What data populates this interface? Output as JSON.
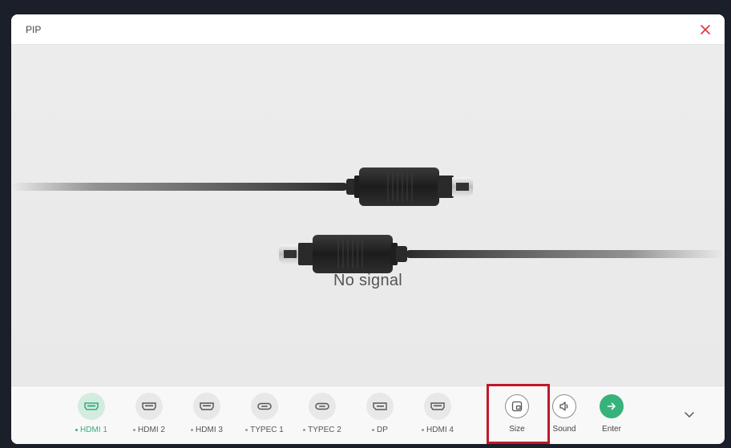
{
  "window": {
    "title": "PIP"
  },
  "content": {
    "message": "No signal"
  },
  "sources": [
    {
      "label": "HDMI 1",
      "active": true
    },
    {
      "label": "HDMI 2",
      "active": false
    },
    {
      "label": "HDMI 3",
      "active": false
    },
    {
      "label": "TYPEC 1",
      "active": false
    },
    {
      "label": "TYPEC 2",
      "active": false
    },
    {
      "label": "DP",
      "active": false
    },
    {
      "label": "HDMI 4",
      "active": false
    }
  ],
  "actions": {
    "size": "Size",
    "sound": "Sound",
    "enter": "Enter"
  },
  "colors": {
    "accent_green": "#37b27a",
    "close_red": "#e0313f",
    "highlight_red": "#c0182b"
  },
  "icons": {
    "close": "close-icon",
    "expand": "chevron-down-icon",
    "size": "pip-size-icon",
    "sound": "speaker-icon",
    "enter": "arrow-right-icon"
  }
}
